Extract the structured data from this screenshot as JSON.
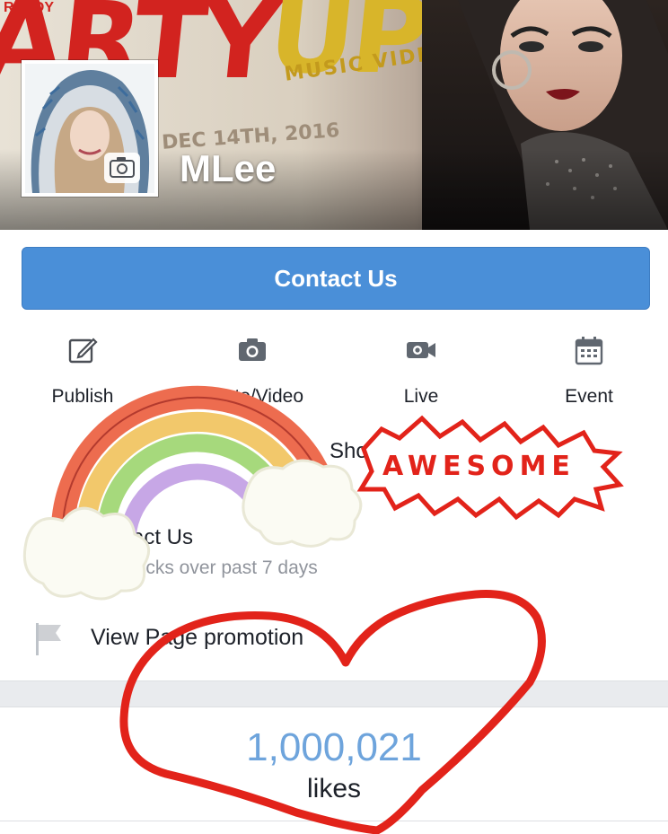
{
  "cover": {
    "headline_left": "ARTY",
    "headline_right": "UP",
    "kicker": "READY",
    "subtitle": "MUSIC VIDEO",
    "date": "DEC 14TH, 2016"
  },
  "profile": {
    "page_name": "MLee"
  },
  "contact_button": {
    "label": "Contact Us"
  },
  "actions": [
    {
      "label": "Publish",
      "icon": "pencil-square-icon"
    },
    {
      "label": "Photo/Video",
      "icon": "camera-icon"
    },
    {
      "label": "Live",
      "icon": "video-camera-icon"
    },
    {
      "label": "Event",
      "icon": "calendar-icon"
    }
  ],
  "obscured_rows": {
    "shop_fragment": "Sho",
    "contact_title_fragment": "act Us",
    "contact_sub_fragment": "licks over past 7 days"
  },
  "promotion": {
    "label": "View Page promotion",
    "icon": "flag-icon"
  },
  "likes": {
    "count": "1,000,021",
    "label": "likes"
  },
  "stickers": {
    "awesome": "AWESOME"
  },
  "colors": {
    "accent": "#4a8fd8",
    "likes_blue": "#6ea4dc",
    "heart_red": "#e2231a"
  }
}
